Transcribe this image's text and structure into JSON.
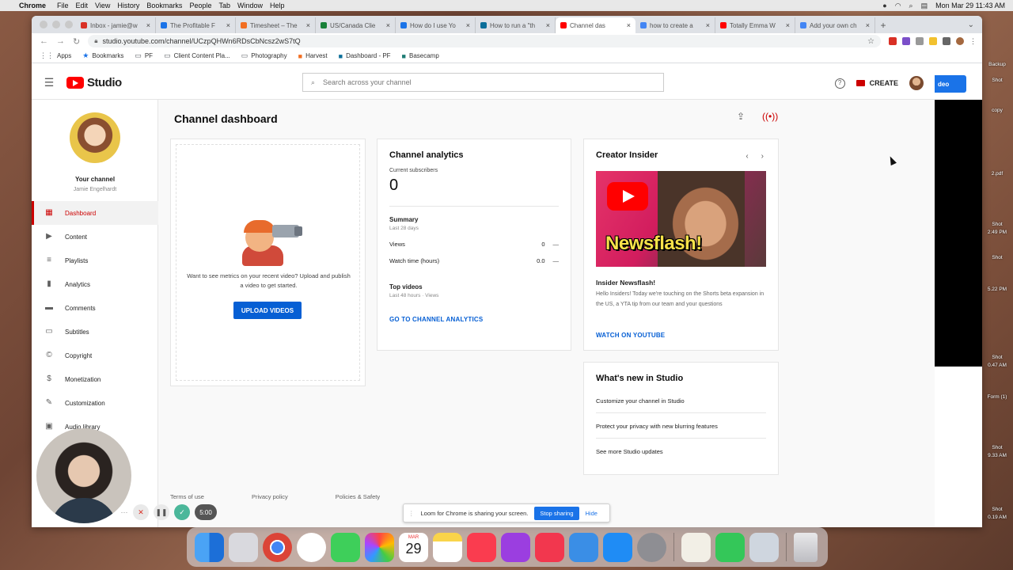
{
  "menubar": {
    "app": "Chrome",
    "items": [
      "File",
      "Edit",
      "View",
      "History",
      "Bookmarks",
      "People",
      "Tab",
      "Window",
      "Help"
    ],
    "clock": "Mon Mar 29  11:43 AM"
  },
  "tabs": [
    {
      "label": "Inbox - jamie@w",
      "color": "#d93025",
      "active": false
    },
    {
      "label": "The Profitable F",
      "color": "#1a73e8",
      "active": false
    },
    {
      "label": "Timesheet – The",
      "color": "#f26e21",
      "active": false
    },
    {
      "label": "US/Canada Clie",
      "color": "#188038",
      "active": false
    },
    {
      "label": "How do I use Yo",
      "color": "#1a73e8",
      "active": false
    },
    {
      "label": "How to run a \"th",
      "color": "#0b6e99",
      "active": false
    },
    {
      "label": "Channel das",
      "color": "#ff0000",
      "active": true
    },
    {
      "label": "how to create a",
      "color": "#4285f4",
      "active": false
    },
    {
      "label": "Totally Emma W",
      "color": "#ff0000",
      "active": false
    },
    {
      "label": "Add your own ch",
      "color": "#4285f4",
      "active": false
    }
  ],
  "url": "studio.youtube.com/channel/UCzpQHWn6RDsCbNcsz2wS7tQ",
  "bookmarks": [
    "Apps",
    "Bookmarks",
    "PF",
    "Client Content Pla...",
    "Photography",
    "Harvest",
    "Dashboard - PF",
    "Basecamp"
  ],
  "studio": {
    "logo_text": "Studio",
    "search_placeholder": "Search across your channel",
    "create_label": "CREATE",
    "channel_label": "Your channel",
    "channel_name": "Jamie Engelhardt",
    "nav": [
      {
        "label": "Dashboard",
        "icon": "dashboard-icon",
        "active": true
      },
      {
        "label": "Content",
        "icon": "content-icon",
        "active": false
      },
      {
        "label": "Playlists",
        "icon": "playlists-icon",
        "active": false
      },
      {
        "label": "Analytics",
        "icon": "analytics-icon",
        "active": false
      },
      {
        "label": "Comments",
        "icon": "comments-icon",
        "active": false
      },
      {
        "label": "Subtitles",
        "icon": "subtitles-icon",
        "active": false
      },
      {
        "label": "Copyright",
        "icon": "copyright-icon",
        "active": false
      },
      {
        "label": "Monetization",
        "icon": "monetization-icon",
        "active": false
      },
      {
        "label": "Customization",
        "icon": "customization-icon",
        "active": false
      },
      {
        "label": "Audio library",
        "icon": "audio-library-icon",
        "active": false
      }
    ],
    "page_title": "Channel dashboard",
    "upload_card": {
      "message": "Want to see metrics on your recent video? Upload and publish a video to get started.",
      "button": "UPLOAD VIDEOS"
    },
    "analytics": {
      "title": "Channel analytics",
      "subs_label": "Current subscribers",
      "subs_value": "0",
      "summary_title": "Summary",
      "summary_period": "Last 28 days",
      "rows": [
        {
          "label": "Views",
          "value": "0",
          "delta": "—"
        },
        {
          "label": "Watch time (hours)",
          "value": "0.0",
          "delta": "—"
        }
      ],
      "top_videos": "Top videos",
      "top_videos_sub": "Last 48 hours · Views",
      "link": "GO TO CHANNEL ANALYTICS"
    },
    "insider": {
      "title": "Creator Insider",
      "thumb_text": "Newsflash!",
      "video_title": "Insider Newsflash!",
      "desc": "Hello Insiders! Today we're touching on the Shorts beta expansion in the US, a YTA tip from our team and your questions",
      "link": "WATCH ON YOUTUBE"
    },
    "whats_new": {
      "title": "What's new in Studio",
      "items": [
        "Customize your channel in Studio",
        "Protect your privacy with new blurring features",
        "See more Studio updates"
      ]
    },
    "footer": [
      "Terms of use",
      "Privacy policy",
      "Policies & Safety"
    ]
  },
  "loom": {
    "message": "Loom for Chrome is sharing your screen.",
    "stop": "Stop sharing",
    "hide": "Hide"
  },
  "recording": {
    "timer": "5:00"
  },
  "overlay_button": "deo",
  "desktop_items": [
    "Backup",
    "Shot",
    "copy",
    "2.pdf",
    "Shot",
    "2:49 PM",
    "Shot",
    "5.22 PM",
    "Shot",
    "0.47 AM",
    "Form (1)",
    "Shot",
    "9.33 AM",
    "Shot",
    "0.19 AM"
  ],
  "dock": {
    "calendar_month": "MAR",
    "calendar_day": "29"
  }
}
